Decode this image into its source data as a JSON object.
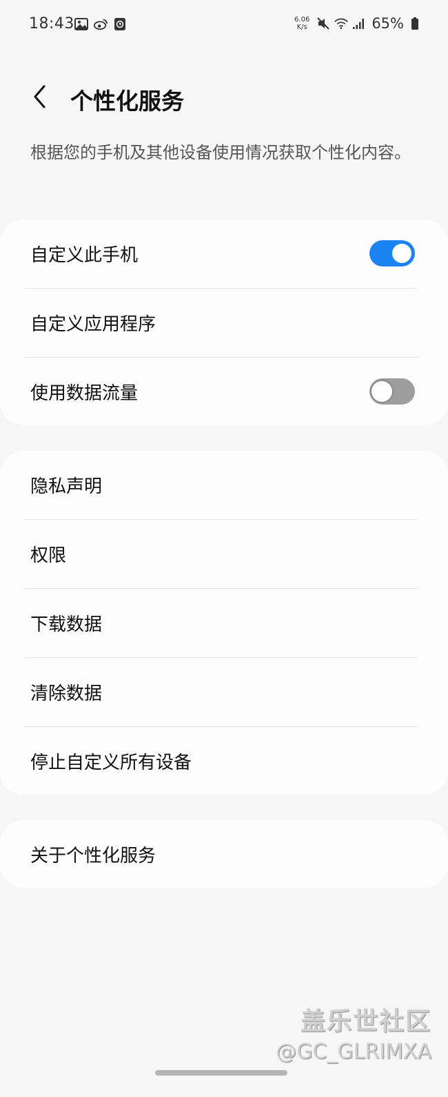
{
  "status_bar": {
    "time": "18:43",
    "net_speed_value": "6.06",
    "net_speed_unit": "K/s",
    "battery": "65%",
    "left_icons": [
      "gallery-icon",
      "weibo-icon",
      "clock-app-icon"
    ],
    "right_icons": [
      "mute-icon",
      "wifi-icon",
      "signal-icon",
      "battery-icon"
    ]
  },
  "header": {
    "title": "个性化服务",
    "back_icon": "chevron-left-icon"
  },
  "description": "根据您的手机及其他设备使用情况获取个性化内容。",
  "group1": {
    "items": [
      {
        "label": "自定义此手机",
        "toggle": "on"
      },
      {
        "label": "自定义应用程序"
      },
      {
        "label": "使用数据流量",
        "toggle": "off"
      }
    ]
  },
  "group2": {
    "items": [
      {
        "label": "隐私声明"
      },
      {
        "label": "权限"
      },
      {
        "label": "下载数据"
      },
      {
        "label": "清除数据"
      },
      {
        "label": "停止自定义所有设备"
      }
    ]
  },
  "group3": {
    "items": [
      {
        "label": "关于个性化服务"
      }
    ]
  },
  "watermark": {
    "title": "盖乐世社区",
    "handle": "@GC_GLRIMXA"
  },
  "colors": {
    "accent": "#1b82f1",
    "background": "#f6f6f6",
    "card": "#fdfdfd",
    "toggle_off": "#9e9e9e"
  }
}
